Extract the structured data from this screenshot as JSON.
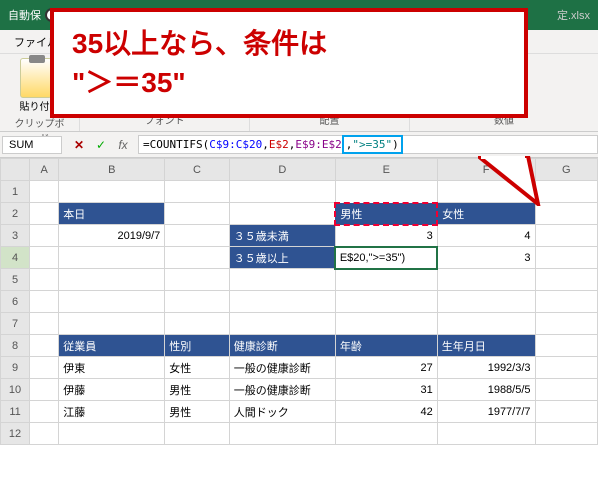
{
  "titlebar": {
    "autosave_label": "自動保",
    "filename": "定.xlsx"
  },
  "menubar": {
    "file": "ファイル"
  },
  "ribbon": {
    "clipboard": {
      "paste_label": "貼り付け",
      "group_label": "クリップボード"
    },
    "font": {
      "group_label": "フォント"
    },
    "align": {
      "group_label": "配置"
    },
    "number": {
      "group_label": "数値"
    }
  },
  "formula": {
    "name_box": "SUM",
    "fx": "fx",
    "prefix": "=COUNTIFS(",
    "a1": "C$9:C$20",
    "a2": "E$2",
    "a3": "E$9:E$2",
    "a4": "\">=35\"",
    "suffix": ")"
  },
  "cols": {
    "A": "A",
    "B": "B",
    "C": "C",
    "D": "D",
    "E": "E",
    "F": "F",
    "G": "G"
  },
  "rows": [
    "1",
    "2",
    "3",
    "4",
    "5",
    "6",
    "7",
    "8",
    "9",
    "10",
    "11",
    "12"
  ],
  "cells": {
    "B2": "本日",
    "B3": "2019/9/7",
    "D3": "３５歳未満",
    "D4": "３５歳以上",
    "E2": "男性",
    "E3": "3",
    "E4": "E$20,\">=35\")",
    "F2": "女性",
    "F3": "4",
    "F4": "3",
    "B8": "従業員",
    "C8": "性別",
    "D8": "健康診断",
    "E8": "年齢",
    "F8": "生年月日",
    "B9": "伊東",
    "C9": "女性",
    "D9": "一般の健康診断",
    "E9": "27",
    "F9": "1992/3/3",
    "B10": "伊藤",
    "C10": "男性",
    "D10": "一般の健康診断",
    "E10": "31",
    "F10": "1988/5/5",
    "B11": "江藤",
    "C11": "男性",
    "D11": "人間ドック",
    "E11": "42",
    "F11": "1977/7/7"
  },
  "callout": {
    "line1": "35以上なら、条件は",
    "line2": "\"＞＝35\""
  }
}
